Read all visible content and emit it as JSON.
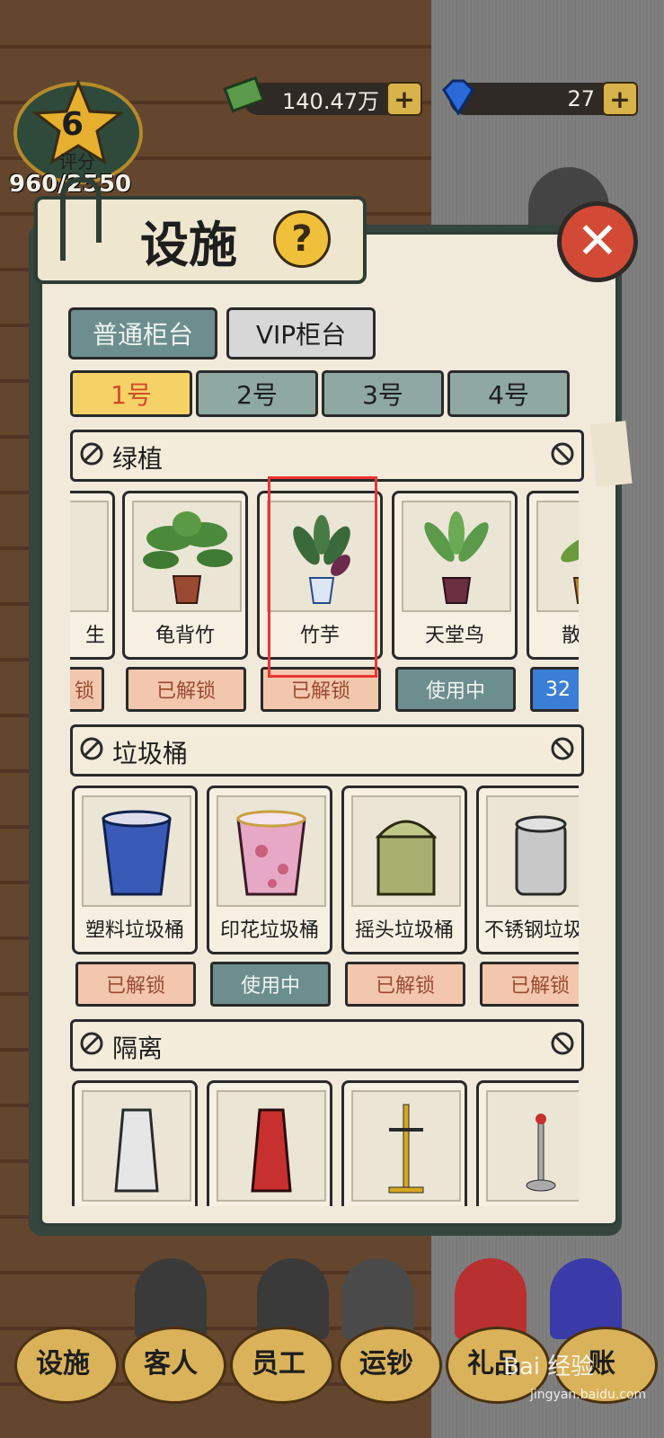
{
  "hud": {
    "money": "140.47万",
    "gems": "27",
    "plus": "+"
  },
  "level": {
    "number": "6",
    "label": "评分",
    "score": "960/2550"
  },
  "panel": {
    "title": "设施",
    "help": "?",
    "close": "✕"
  },
  "tabs": {
    "normal": "普通柜台",
    "vip": "VIP柜台"
  },
  "counters": [
    "1号",
    "2号",
    "3号",
    "4号"
  ],
  "sections": {
    "plants": {
      "title": "绿植",
      "items": [
        {
          "name": "龟背竹",
          "status": "已解锁"
        },
        {
          "name": "竹芋",
          "status": "已解锁"
        },
        {
          "name": "天堂鸟",
          "status": "使用中"
        },
        {
          "name": "散",
          "status": "32"
        }
      ],
      "partial_left_status": "锁",
      "partial_left_name": "生"
    },
    "trash": {
      "title": "垃圾桶",
      "items": [
        {
          "name": "塑料垃圾桶",
          "status": "已解锁"
        },
        {
          "name": "印花垃圾桶",
          "status": "使用中"
        },
        {
          "name": "摇头垃圾桶",
          "status": "已解锁"
        },
        {
          "name": "不锈钢垃圾桶",
          "status": "已解锁"
        }
      ]
    },
    "barrier": {
      "title": "隔离"
    }
  },
  "nav": [
    "设施",
    "客人",
    "员工",
    "运钞",
    "礼品",
    "账"
  ],
  "watermark": {
    "brand": "Bai 经验",
    "url": "jingyan.baidu.com"
  },
  "colors": {
    "accent": "#6d8e8e",
    "highlight": "#e33333",
    "unlocked": "#f2c7ad"
  }
}
